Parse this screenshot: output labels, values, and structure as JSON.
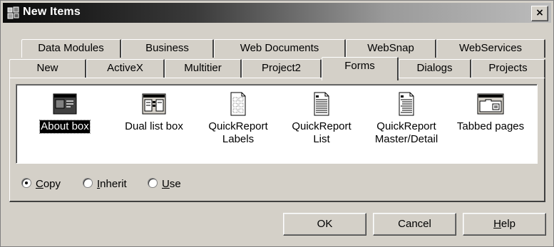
{
  "window": {
    "title": "New Items",
    "close_glyph": "×"
  },
  "tabs": {
    "row1": [
      "Data Modules",
      "Business",
      "Web Documents",
      "WebSnap",
      "WebServices"
    ],
    "row2": [
      "New",
      "ActiveX",
      "Multitier",
      "Project2",
      "Forms",
      "Dialogs",
      "Projects"
    ],
    "active": "Forms"
  },
  "items": [
    {
      "label": "About box",
      "icon": "about-box-form-icon",
      "selected": true
    },
    {
      "label": "Dual list box",
      "icon": "dual-list-form-icon"
    },
    {
      "label_line1": "QuickReport",
      "label_line2": "Labels",
      "icon": "report-labels-icon"
    },
    {
      "label_line1": "QuickReport",
      "label_line2": "List",
      "icon": "report-list-icon"
    },
    {
      "label_line1": "QuickReport",
      "label_line2": "Master/Detail",
      "icon": "report-master-detail-icon"
    },
    {
      "label": "Tabbed pages",
      "icon": "tabbed-pages-form-icon"
    }
  ],
  "options": {
    "copy": {
      "mnemonic": "C",
      "rest": "opy",
      "checked": true
    },
    "inherit": {
      "mnemonic": "I",
      "rest": "nherit",
      "checked": false
    },
    "use": {
      "mnemonic": "U",
      "rest": "se",
      "checked": false
    }
  },
  "buttons": {
    "ok": "OK",
    "cancel": "Cancel",
    "help_mnemonic": "H",
    "help_rest": "elp"
  }
}
